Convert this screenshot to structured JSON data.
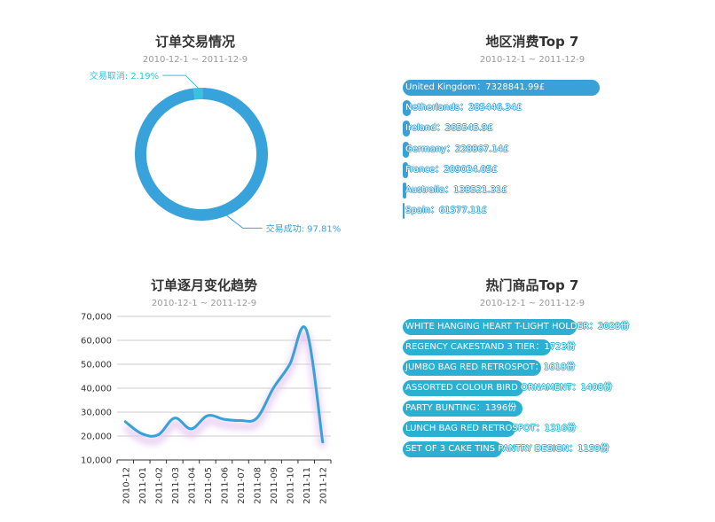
{
  "colors": {
    "pie_main": "#38a2db",
    "pie_cancel": "#35c3e0",
    "region_bar": "#3aa0d8",
    "product_bar": "#2bb0d4",
    "line": "#35a2d8",
    "line_shadow": "#e6c8f0",
    "grid": "#cccccc",
    "axis_text": "#333333"
  },
  "panels": {
    "orders": {
      "title": "订单交易情况",
      "subtitle": "2010-12-1 ~ 2011-12-9"
    },
    "regions": {
      "title": "地区消费Top 7",
      "subtitle": "2010-12-1 ~ 2011-12-9"
    },
    "monthly": {
      "title": "订单逐月变化趋势",
      "subtitle": "2010-12-1 ~ 2011-12-9"
    },
    "products": {
      "title": "热门商品Top 7",
      "subtitle": "2010-12-1 ~ 2011-12-9"
    }
  },
  "chart_data": [
    {
      "id": "orders",
      "type": "pie",
      "style": "donut",
      "slices": [
        {
          "label": "交易成功",
          "value": 97.81,
          "label_text": "交易成功: 97.81%"
        },
        {
          "label": "交易取消",
          "value": 2.19,
          "label_text": "交易取消: 2.19%"
        }
      ]
    },
    {
      "id": "regions",
      "type": "bar",
      "orientation": "horizontal",
      "categories": [
        "United Kingdom",
        "Netherlands",
        "Ireland",
        "Germany",
        "France",
        "Australia",
        "Spain"
      ],
      "values": [
        7328841.99,
        285446.34,
        265545.9,
        228867.14,
        209024.05,
        138521.31,
        61577.11
      ],
      "labels": [
        "United Kingdom：7328841.99£",
        "Netherlands：285446.34£",
        "Ireland：265545.9£",
        "Germany：228867.14£",
        "France：209024.05£",
        "Australia：138521.31£",
        "Spain：61577.11£"
      ]
    },
    {
      "id": "monthly",
      "type": "line",
      "smooth": true,
      "x": [
        "2010-12",
        "2011-01",
        "2011-02",
        "2011-03",
        "2011-04",
        "2011-05",
        "2011-06",
        "2011-07",
        "2011-08",
        "2011-09",
        "2011-10",
        "2011-11",
        "2011-12"
      ],
      "values": [
        26000,
        21000,
        20500,
        27500,
        23000,
        28500,
        27000,
        26500,
        27500,
        40000,
        50000,
        64500,
        17500
      ],
      "ylim": [
        10000,
        70000
      ],
      "yticks": [
        "10,000",
        "20,000",
        "30,000",
        "40,000",
        "50,000",
        "60,000",
        "70,000"
      ],
      "grid": true
    },
    {
      "id": "products",
      "type": "bar",
      "orientation": "horizontal",
      "categories": [
        "WHITE HANGING HEART T-LIGHT HOLDER",
        "REGENCY CAKESTAND 3 TIER",
        "JUMBO BAG RED RETROSPOT",
        "ASSORTED COLOUR BIRD ORNAMENT",
        "PARTY BUNTING",
        "LUNCH BAG RED RETROSPOT",
        "SET OF 3 CAKE TINS PANTRY DESIGN"
      ],
      "values": [
        2028,
        1723,
        1618,
        1408,
        1396,
        1316,
        1159
      ],
      "labels": [
        "WHITE HANGING HEART T-LIGHT HOLDER：2028份",
        "REGENCY CAKESTAND 3 TIER：1723份",
        "JUMBO BAG RED RETROSPOT：1618份",
        "ASSORTED COLOUR BIRD ORNAMENT：1408份",
        "PARTY BUNTING：1396份",
        "LUNCH BAG RED RETROSPOT：1316份",
        "SET OF 3 CAKE TINS PANTRY DESIGN：1159份"
      ]
    }
  ]
}
